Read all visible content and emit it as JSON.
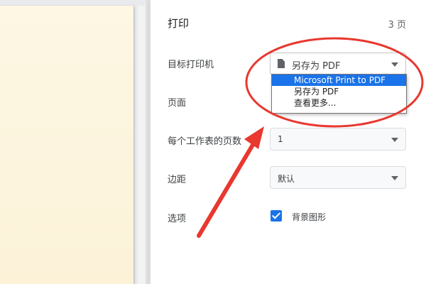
{
  "panel": {
    "title": "打印",
    "page_count": "3 页"
  },
  "destination": {
    "label": "目标打印机",
    "selected": "另存为 PDF",
    "file_icon": "file-icon",
    "options": [
      "Microsoft Print to PDF",
      "另存为 PDF",
      "查看更多..."
    ]
  },
  "pages_setting": {
    "label": "页面"
  },
  "pages_per_sheet": {
    "label": "每个工作表的页数",
    "value": "1"
  },
  "margins": {
    "label": "边距",
    "value": "默认"
  },
  "options": {
    "label": "选项",
    "background_graphics": "背景图形",
    "checked": true
  },
  "colors": {
    "accent": "#1a73e8",
    "annotation": "#e8382f"
  }
}
